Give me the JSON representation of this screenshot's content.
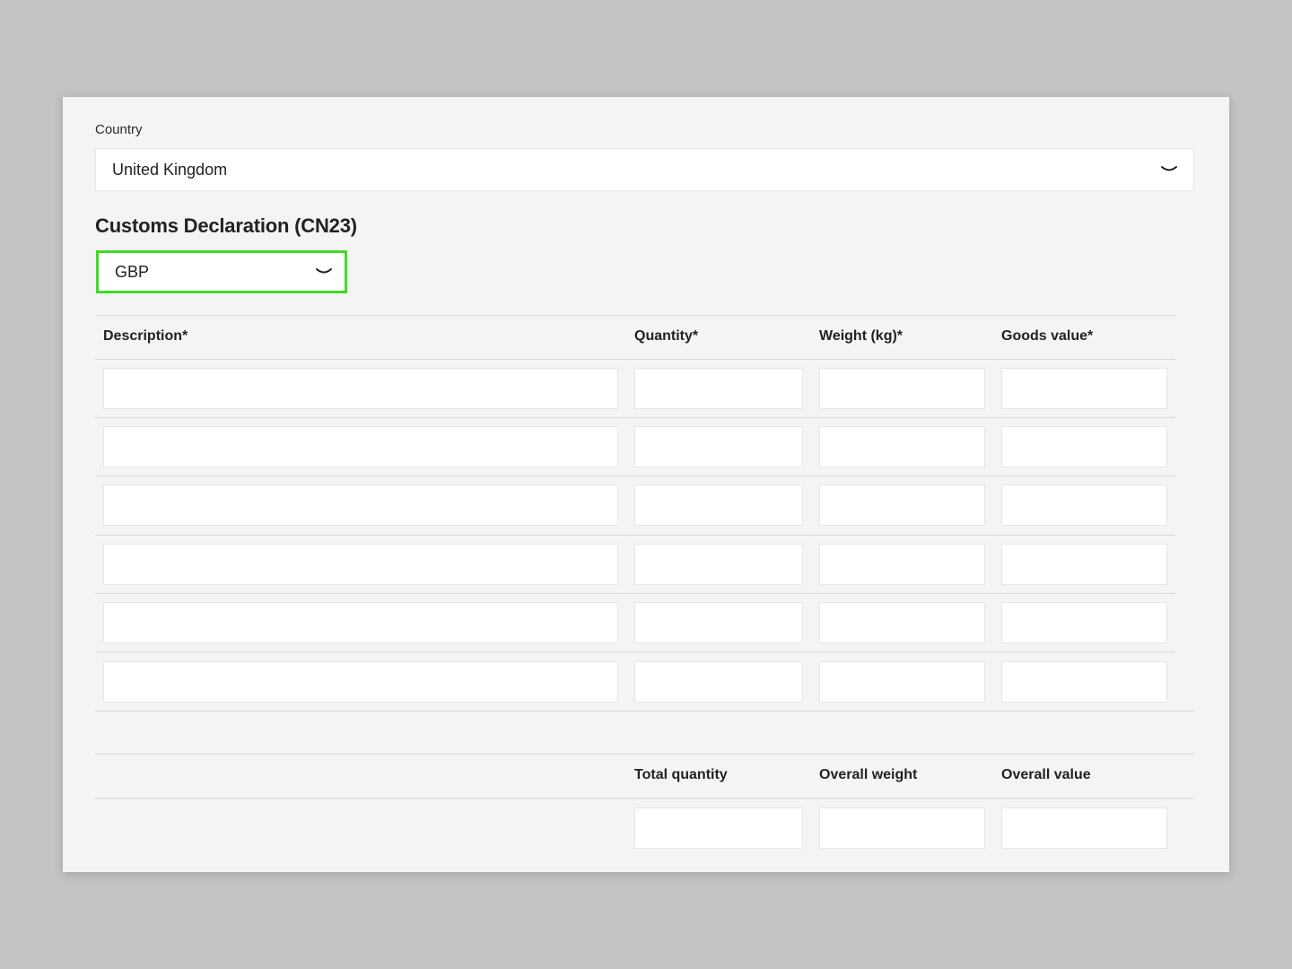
{
  "country": {
    "label": "Country",
    "selected": "United Kingdom"
  },
  "customs": {
    "title": "Customs Declaration (CN23)",
    "currency": "GBP"
  },
  "table": {
    "headers": {
      "description": "Description*",
      "quantity": "Quantity*",
      "weight": "Weight (kg)*",
      "value": "Goods value*"
    },
    "rows": [
      {
        "description": "",
        "quantity": "",
        "weight": "",
        "value": ""
      },
      {
        "description": "",
        "quantity": "",
        "weight": "",
        "value": ""
      },
      {
        "description": "",
        "quantity": "",
        "weight": "",
        "value": ""
      },
      {
        "description": "",
        "quantity": "",
        "weight": "",
        "value": ""
      },
      {
        "description": "",
        "quantity": "",
        "weight": "",
        "value": ""
      },
      {
        "description": "",
        "quantity": "",
        "weight": "",
        "value": ""
      }
    ]
  },
  "totals": {
    "headers": {
      "quantity": "Total quantity",
      "weight": "Overall weight",
      "value": "Overall value"
    },
    "values": {
      "quantity": "",
      "weight": "",
      "value": ""
    }
  },
  "colors": {
    "focus_outline": "#3ddc22",
    "card_background": "#f4f4f4",
    "page_background": "#c3c3c3"
  },
  "icons": {
    "select_chevron": "chevron-down-icon"
  }
}
